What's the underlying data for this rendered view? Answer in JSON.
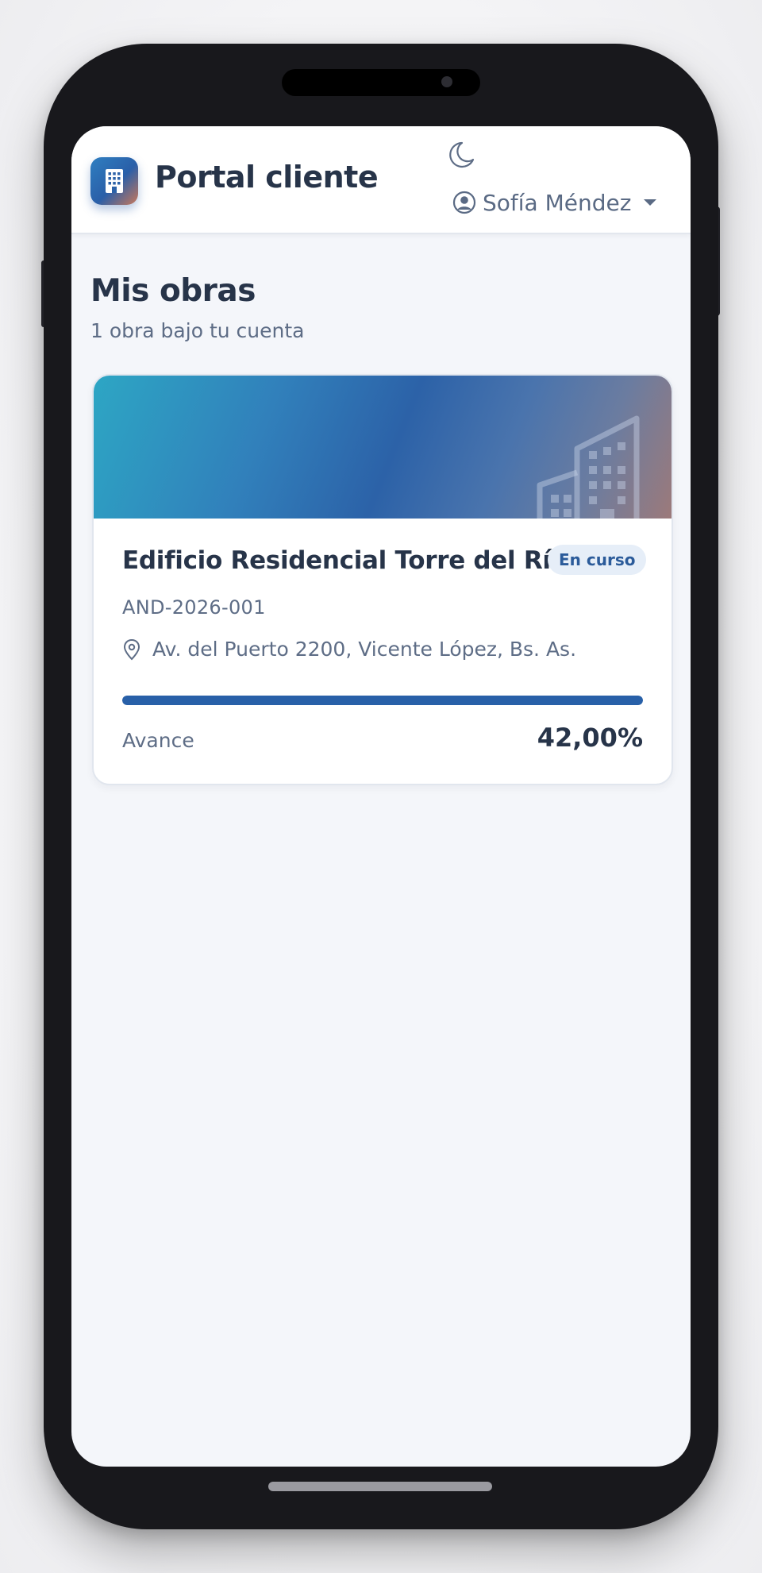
{
  "header": {
    "app_title": "Portal cliente",
    "user_name": "Sofía Méndez",
    "theme_toggle_icon": "moon-icon",
    "logo_icon": "building-icon"
  },
  "main": {
    "title": "Mis obras",
    "subtitle": "1 obra bajo tu cuenta",
    "projects": [
      {
        "name": "Edificio Residencial Torre del Río",
        "status": "En curso",
        "code": "AND-2026-001",
        "address": "Av. del Puerto 2200, Vicente López, Bs. As.",
        "progress_label": "Avance",
        "progress_text": "42,00%",
        "progress_bar_fill": 1.0
      }
    ]
  },
  "colors": {
    "brand": "#2860a8",
    "text_primary": "#273449",
    "text_muted": "#5e6d86",
    "badge_bg": "#e6eef8",
    "device_frame": "#18181c"
  }
}
